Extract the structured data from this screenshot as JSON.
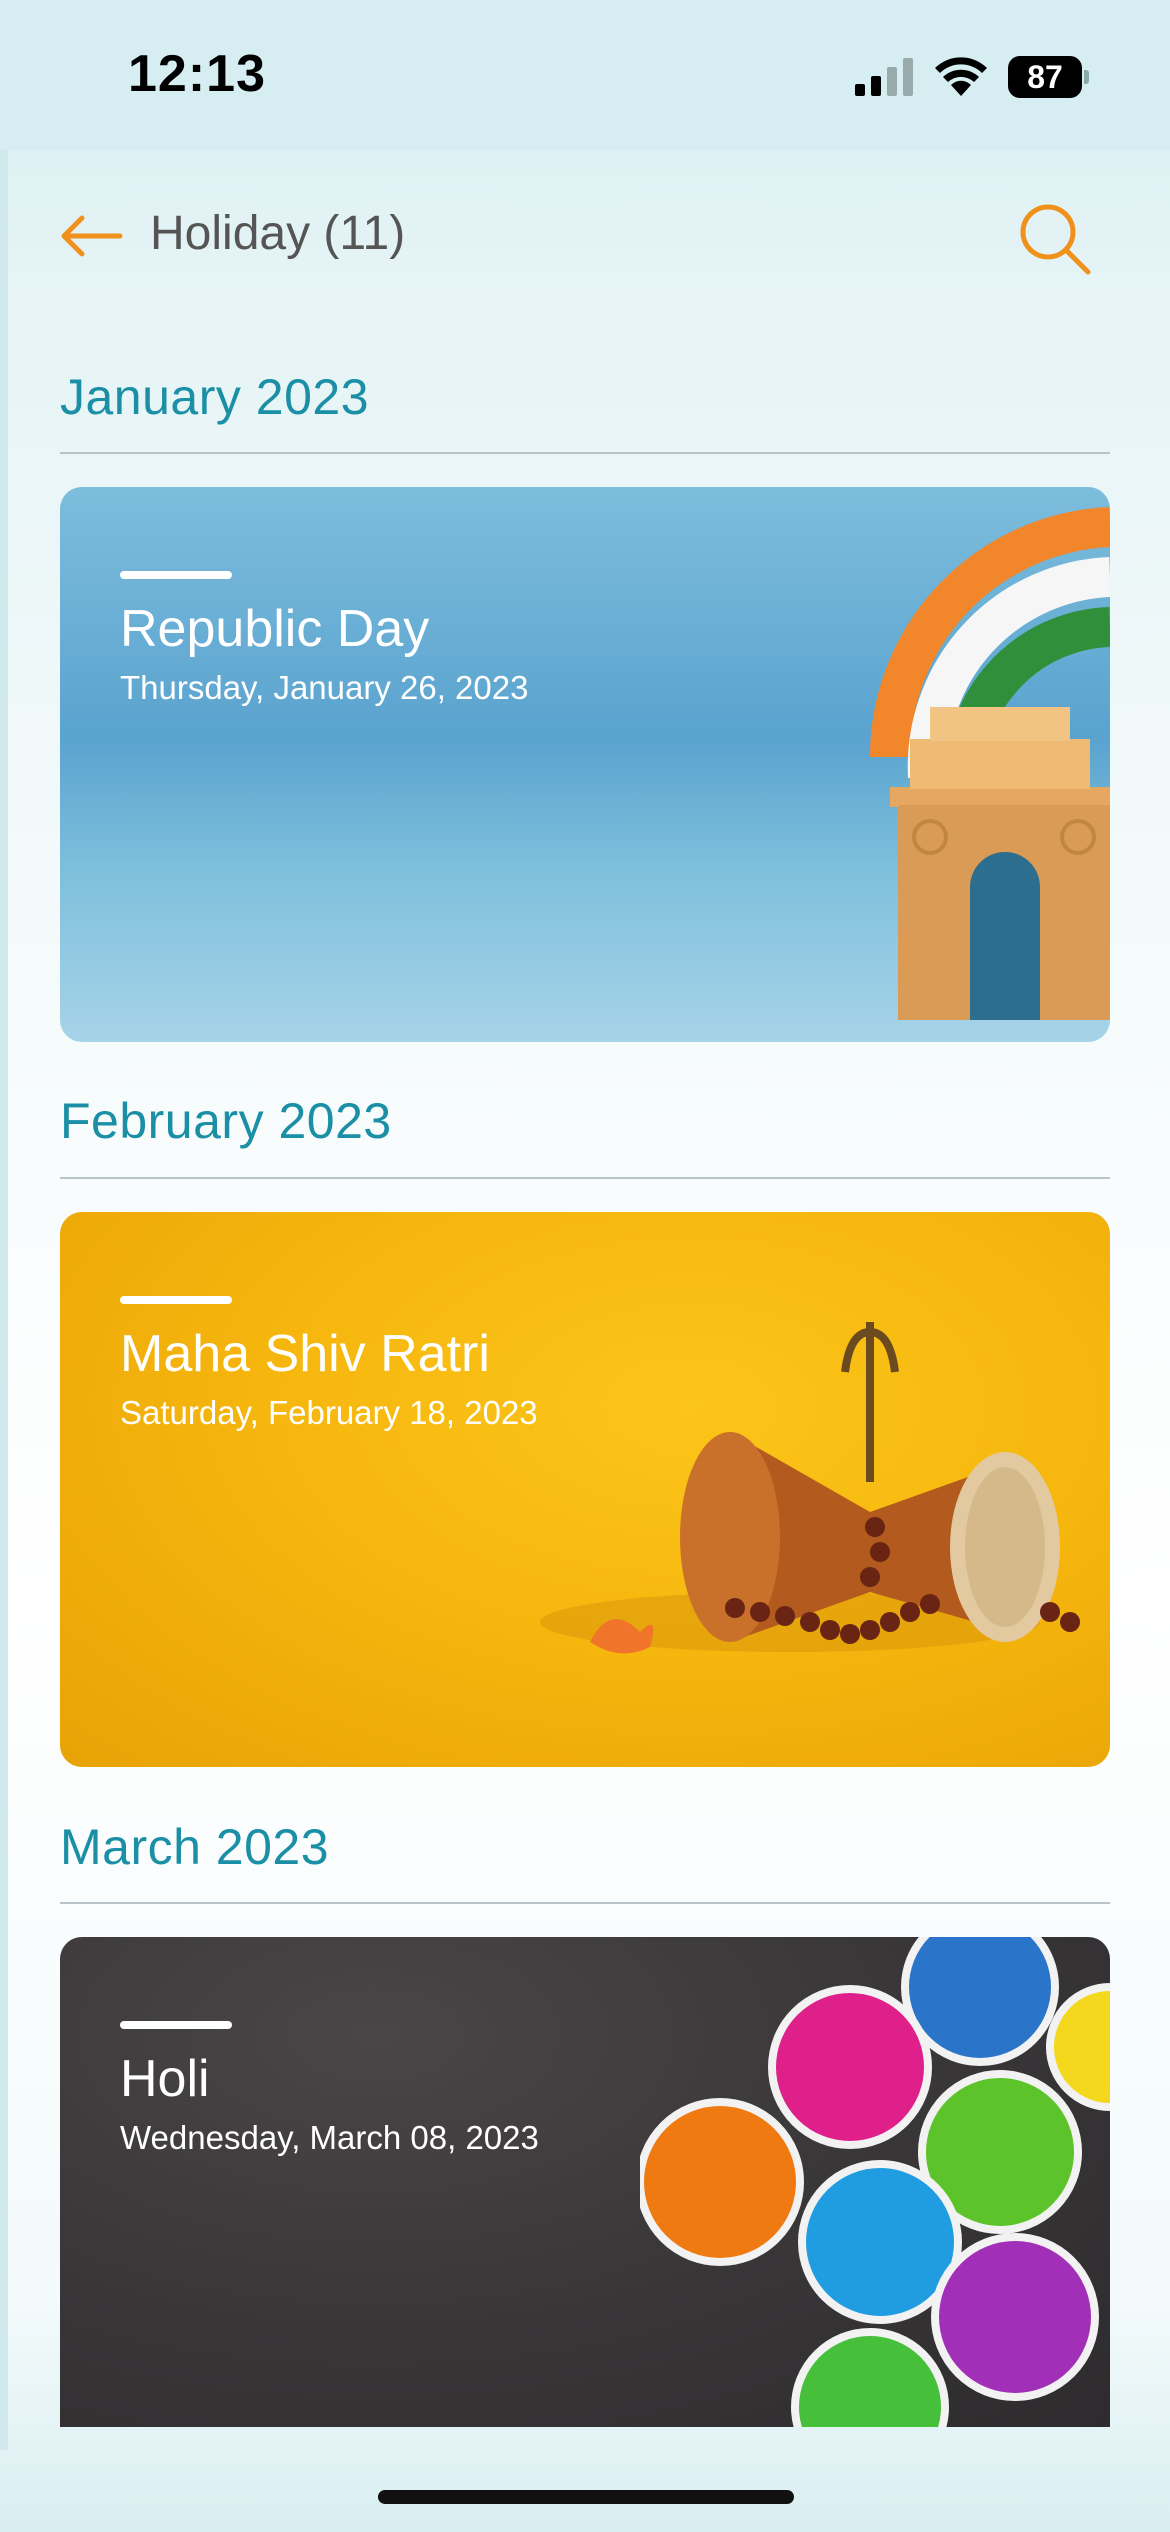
{
  "status_bar": {
    "time": "12:13",
    "battery": "87"
  },
  "header": {
    "title": "Holiday (11)"
  },
  "sections": [
    {
      "month": "January 2023",
      "holiday": {
        "name": "Republic Day",
        "date": "Thursday, January 26, 2023"
      }
    },
    {
      "month": "February 2023",
      "holiday": {
        "name": "Maha Shiv Ratri",
        "date": "Saturday, February 18, 2023"
      }
    },
    {
      "month": "March 2023",
      "holiday": {
        "name": "Holi",
        "date": "Wednesday, March 08, 2023"
      }
    }
  ],
  "icons": {
    "back": "arrow-left-icon",
    "search": "search-icon",
    "signal": "cellular-signal-icon",
    "wifi": "wifi-icon",
    "battery": "battery-icon"
  },
  "colors": {
    "accent_orange": "#f0911c",
    "month_teal": "#1a8fa5",
    "title_gray": "#555555"
  }
}
